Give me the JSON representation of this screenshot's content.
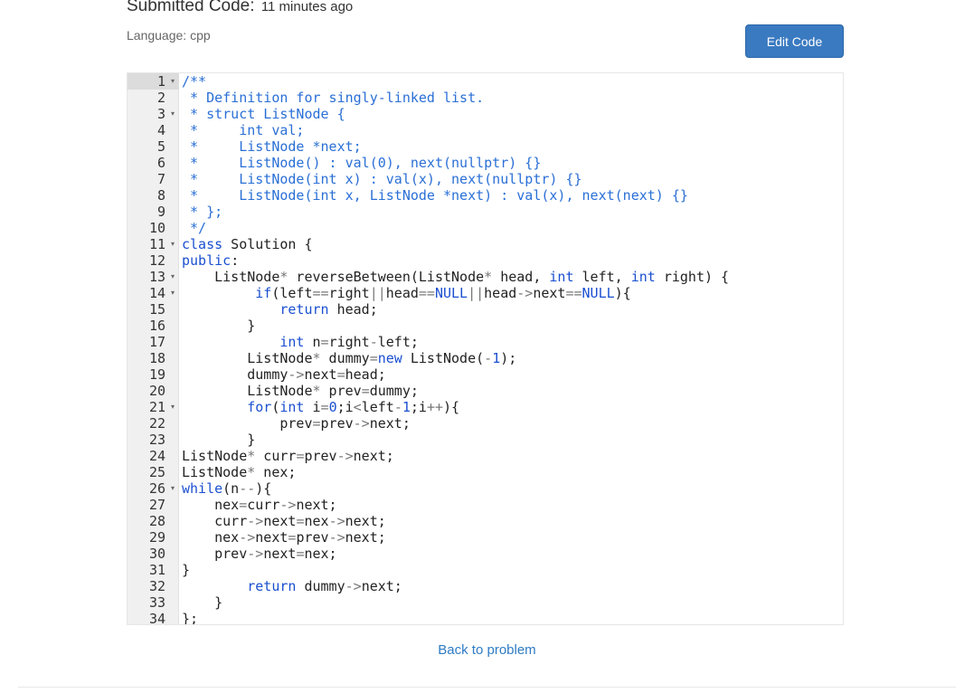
{
  "header": {
    "title": "Submitted Code:",
    "time": "11 minutes ago",
    "language": "Language: cpp",
    "edit_label": "Edit Code"
  },
  "editor": {
    "active_line": 1,
    "lines": [
      {
        "n": "1",
        "fold": true,
        "tokens": [
          [
            "c",
            "/**"
          ]
        ]
      },
      {
        "n": "2",
        "fold": false,
        "tokens": [
          [
            "c",
            " * Definition for singly-linked list."
          ]
        ]
      },
      {
        "n": "3",
        "fold": true,
        "tokens": [
          [
            "c",
            " * struct ListNode {"
          ]
        ]
      },
      {
        "n": "4",
        "fold": false,
        "tokens": [
          [
            "c",
            " *     int val;"
          ]
        ]
      },
      {
        "n": "5",
        "fold": false,
        "tokens": [
          [
            "c",
            " *     ListNode *next;"
          ]
        ]
      },
      {
        "n": "6",
        "fold": false,
        "tokens": [
          [
            "c",
            " *     ListNode() : val(0), next(nullptr) {}"
          ]
        ]
      },
      {
        "n": "7",
        "fold": false,
        "tokens": [
          [
            "c",
            " *     ListNode(int x) : val(x), next(nullptr) {}"
          ]
        ]
      },
      {
        "n": "8",
        "fold": false,
        "tokens": [
          [
            "c",
            " *     ListNode(int x, ListNode *next) : val(x), next(next) {}"
          ]
        ]
      },
      {
        "n": "9",
        "fold": false,
        "tokens": [
          [
            "c",
            " * };"
          ]
        ]
      },
      {
        "n": "10",
        "fold": false,
        "tokens": [
          [
            "c",
            " */"
          ]
        ]
      },
      {
        "n": "11",
        "fold": true,
        "tokens": [
          [
            "k",
            "class"
          ],
          [
            "i",
            " Solution {"
          ]
        ]
      },
      {
        "n": "12",
        "fold": false,
        "tokens": [
          [
            "k",
            "public"
          ],
          [
            "i",
            ":"
          ]
        ]
      },
      {
        "n": "13",
        "fold": true,
        "tokens": [
          [
            "i",
            "    ListNode"
          ],
          [
            "o",
            "*"
          ],
          [
            "i",
            " reverseBetween(ListNode"
          ],
          [
            "o",
            "*"
          ],
          [
            "i",
            " head, "
          ],
          [
            "k",
            "int"
          ],
          [
            "i",
            " left, "
          ],
          [
            "k",
            "int"
          ],
          [
            "i",
            " right) {"
          ]
        ]
      },
      {
        "n": "14",
        "fold": true,
        "tokens": [
          [
            "i",
            "         "
          ],
          [
            "k",
            "if"
          ],
          [
            "i",
            "(left"
          ],
          [
            "o",
            "=="
          ],
          [
            "i",
            "right"
          ],
          [
            "o",
            "||"
          ],
          [
            "i",
            "head"
          ],
          [
            "o",
            "=="
          ],
          [
            "k",
            "NULL"
          ],
          [
            "o",
            "||"
          ],
          [
            "i",
            "head"
          ],
          [
            "o",
            "->"
          ],
          [
            "i",
            "next"
          ],
          [
            "o",
            "=="
          ],
          [
            "k",
            "NULL"
          ],
          [
            "i",
            "){"
          ]
        ]
      },
      {
        "n": "15",
        "fold": false,
        "tokens": [
          [
            "i",
            "            "
          ],
          [
            "k",
            "return"
          ],
          [
            "i",
            " head;"
          ]
        ]
      },
      {
        "n": "16",
        "fold": false,
        "tokens": [
          [
            "i",
            "        }"
          ]
        ]
      },
      {
        "n": "17",
        "fold": false,
        "tokens": [
          [
            "i",
            "            "
          ],
          [
            "k",
            "int"
          ],
          [
            "i",
            " n"
          ],
          [
            "o",
            "="
          ],
          [
            "i",
            "right"
          ],
          [
            "o",
            "-"
          ],
          [
            "i",
            "left;"
          ]
        ]
      },
      {
        "n": "18",
        "fold": false,
        "tokens": [
          [
            "i",
            "        ListNode"
          ],
          [
            "o",
            "*"
          ],
          [
            "i",
            " dummy"
          ],
          [
            "o",
            "="
          ],
          [
            "k",
            "new"
          ],
          [
            "i",
            " ListNode("
          ],
          [
            "o",
            "-"
          ],
          [
            "n",
            "1"
          ],
          [
            "i",
            ");"
          ]
        ]
      },
      {
        "n": "19",
        "fold": false,
        "tokens": [
          [
            "i",
            "        dummy"
          ],
          [
            "o",
            "->"
          ],
          [
            "i",
            "next"
          ],
          [
            "o",
            "="
          ],
          [
            "i",
            "head;"
          ]
        ]
      },
      {
        "n": "20",
        "fold": false,
        "tokens": [
          [
            "i",
            "        ListNode"
          ],
          [
            "o",
            "*"
          ],
          [
            "i",
            " prev"
          ],
          [
            "o",
            "="
          ],
          [
            "i",
            "dummy;"
          ]
        ]
      },
      {
        "n": "21",
        "fold": true,
        "tokens": [
          [
            "i",
            "        "
          ],
          [
            "k",
            "for"
          ],
          [
            "i",
            "("
          ],
          [
            "k",
            "int"
          ],
          [
            "i",
            " i"
          ],
          [
            "o",
            "="
          ],
          [
            "n",
            "0"
          ],
          [
            "i",
            ";i"
          ],
          [
            "o",
            "<"
          ],
          [
            "i",
            "left"
          ],
          [
            "o",
            "-"
          ],
          [
            "n",
            "1"
          ],
          [
            "i",
            ";i"
          ],
          [
            "o",
            "++"
          ],
          [
            "i",
            "){"
          ]
        ]
      },
      {
        "n": "22",
        "fold": false,
        "tokens": [
          [
            "i",
            "            prev"
          ],
          [
            "o",
            "="
          ],
          [
            "i",
            "prev"
          ],
          [
            "o",
            "->"
          ],
          [
            "i",
            "next;"
          ]
        ]
      },
      {
        "n": "23",
        "fold": false,
        "tokens": [
          [
            "i",
            "        }"
          ]
        ]
      },
      {
        "n": "24",
        "fold": false,
        "tokens": [
          [
            "i",
            "ListNode"
          ],
          [
            "o",
            "*"
          ],
          [
            "i",
            " curr"
          ],
          [
            "o",
            "="
          ],
          [
            "i",
            "prev"
          ],
          [
            "o",
            "->"
          ],
          [
            "i",
            "next;"
          ]
        ]
      },
      {
        "n": "25",
        "fold": false,
        "tokens": [
          [
            "i",
            "ListNode"
          ],
          [
            "o",
            "*"
          ],
          [
            "i",
            " nex;"
          ]
        ]
      },
      {
        "n": "26",
        "fold": true,
        "tokens": [
          [
            "k",
            "while"
          ],
          [
            "i",
            "(n"
          ],
          [
            "o",
            "--"
          ],
          [
            "i",
            "){"
          ]
        ]
      },
      {
        "n": "27",
        "fold": false,
        "tokens": [
          [
            "i",
            "    nex"
          ],
          [
            "o",
            "="
          ],
          [
            "i",
            "curr"
          ],
          [
            "o",
            "->"
          ],
          [
            "i",
            "next;"
          ]
        ]
      },
      {
        "n": "28",
        "fold": false,
        "tokens": [
          [
            "i",
            "    curr"
          ],
          [
            "o",
            "->"
          ],
          [
            "i",
            "next"
          ],
          [
            "o",
            "="
          ],
          [
            "i",
            "nex"
          ],
          [
            "o",
            "->"
          ],
          [
            "i",
            "next;"
          ]
        ]
      },
      {
        "n": "29",
        "fold": false,
        "tokens": [
          [
            "i",
            "    nex"
          ],
          [
            "o",
            "->"
          ],
          [
            "i",
            "next"
          ],
          [
            "o",
            "="
          ],
          [
            "i",
            "prev"
          ],
          [
            "o",
            "->"
          ],
          [
            "i",
            "next;"
          ]
        ]
      },
      {
        "n": "30",
        "fold": false,
        "tokens": [
          [
            "i",
            "    prev"
          ],
          [
            "o",
            "->"
          ],
          [
            "i",
            "next"
          ],
          [
            "o",
            "="
          ],
          [
            "i",
            "nex;"
          ]
        ]
      },
      {
        "n": "31",
        "fold": false,
        "tokens": [
          [
            "i",
            "}"
          ]
        ]
      },
      {
        "n": "32",
        "fold": false,
        "tokens": [
          [
            "i",
            "        "
          ],
          [
            "k",
            "return"
          ],
          [
            "i",
            " dummy"
          ],
          [
            "o",
            "->"
          ],
          [
            "i",
            "next;"
          ]
        ]
      },
      {
        "n": "33",
        "fold": false,
        "tokens": [
          [
            "i",
            "    }"
          ]
        ]
      },
      {
        "n": "34",
        "fold": false,
        "tokens": [
          [
            "i",
            "};"
          ]
        ]
      }
    ]
  },
  "footer": {
    "back_label": "Back to problem"
  }
}
